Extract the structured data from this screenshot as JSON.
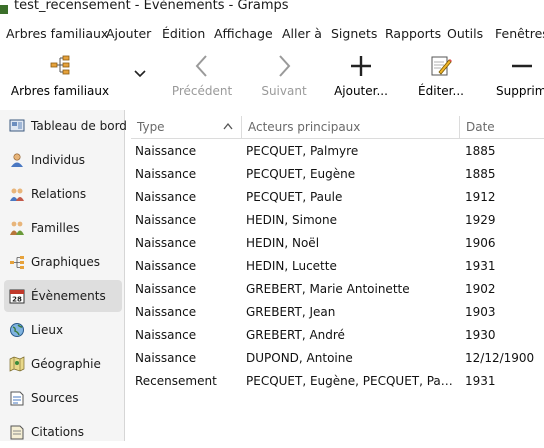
{
  "window": {
    "title": "test_recensement - Evènements - Gramps"
  },
  "menubar": {
    "items": [
      "Arbres familiaux",
      "Ajouter",
      "Édition",
      "Affichage",
      "Aller à",
      "Signets",
      "Rapports",
      "Outils",
      "Fenêtres"
    ]
  },
  "toolbar": {
    "family_trees": "Arbres familiaux",
    "previous": "Précédent",
    "next": "Suivant",
    "add": "Ajouter...",
    "edit": "Éditer...",
    "remove": "Supprimer"
  },
  "sidebar": {
    "items": [
      {
        "label": "Tableau de bord",
        "icon": "dashboard-icon"
      },
      {
        "label": "Individus",
        "icon": "person-icon"
      },
      {
        "label": "Relations",
        "icon": "relations-icon"
      },
      {
        "label": "Familles",
        "icon": "family-icon"
      },
      {
        "label": "Graphiques",
        "icon": "charts-icon"
      },
      {
        "label": "Évènements",
        "icon": "events-icon"
      },
      {
        "label": "Lieux",
        "icon": "places-icon"
      },
      {
        "label": "Géographie",
        "icon": "geography-icon"
      },
      {
        "label": "Sources",
        "icon": "sources-icon"
      },
      {
        "label": "Citations",
        "icon": "citations-icon"
      }
    ],
    "active": "Évènements"
  },
  "table": {
    "columns": [
      "Type",
      "Acteurs principaux",
      "Date"
    ],
    "rows": [
      [
        "Naissance",
        "PECQUET, Palmyre",
        "1885"
      ],
      [
        "Naissance",
        "PECQUET, Eugène",
        "1885"
      ],
      [
        "Naissance",
        "PECQUET, Paule",
        "1912"
      ],
      [
        "Naissance",
        "HEDIN, Simone",
        "1929"
      ],
      [
        "Naissance",
        "HEDIN, Noël",
        "1906"
      ],
      [
        "Naissance",
        "HEDIN, Lucette",
        "1931"
      ],
      [
        "Naissance",
        "GREBERT, Marie Antoinette",
        "1902"
      ],
      [
        "Naissance",
        "GREBERT, Jean",
        "1903"
      ],
      [
        "Naissance",
        "GREBERT, André",
        "1930"
      ],
      [
        "Naissance",
        "DUPOND, Antoine",
        "12/12/1900"
      ],
      [
        "Recensement",
        "PECQUET, Eugène, PECQUET, Paule, G...",
        "1931"
      ]
    ]
  }
}
